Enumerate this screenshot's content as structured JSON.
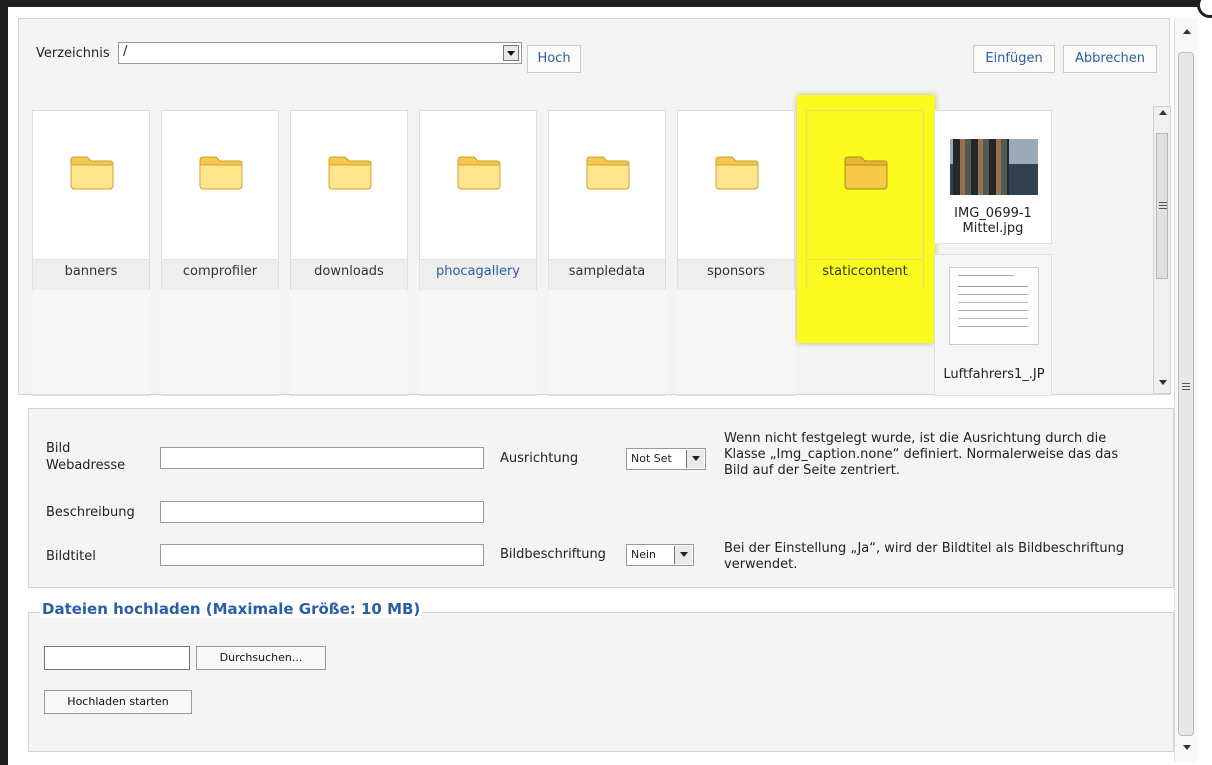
{
  "toolbar": {
    "directory_label": "Verzeichnis",
    "directory_value": "/",
    "up_button": "Hoch",
    "insert_button": "Einfügen",
    "cancel_button": "Abbrechen"
  },
  "items": [
    {
      "label": "banners",
      "type": "folder"
    },
    {
      "label": "comprofiler",
      "type": "folder"
    },
    {
      "label": "downloads",
      "type": "folder"
    },
    {
      "label": "phocagallery",
      "type": "folder"
    },
    {
      "label": "sampledata",
      "type": "folder"
    },
    {
      "label": "sponsors",
      "type": "folder"
    },
    {
      "label": "staticcontent",
      "type": "folder",
      "selected": true
    },
    {
      "label": "IMG_0699-1 Mittel.jpg",
      "type": "image"
    },
    {
      "label": "Luftfahrers1_.JP",
      "type": "image"
    }
  ],
  "form": {
    "image_url_label": "Bild Webadresse",
    "description_label": "Beschreibung",
    "title_label": "Bildtitel",
    "align_label": "Ausrichtung",
    "align_value": "Not Set",
    "align_help": "Wenn nicht festgelegt wurde, ist die Ausrichtung durch die Klasse „Img_caption.none“ definiert. Normalerweise das das Bild auf der Seite zentriert.",
    "caption_label": "Bildbeschriftung",
    "caption_value": "Nein",
    "caption_help": "Bei der Einstellung „Ja“, wird der Bildtitel als Bildbeschriftung verwendet."
  },
  "upload": {
    "legend": "Dateien hochladen (Maximale Größe: 10 MB)",
    "browse_button": "Durchsuchen...",
    "start_button": "Hochladen starten"
  },
  "icons": {
    "folder": "folder-icon",
    "dropdown": "chevron-down-icon",
    "scroll_up": "chevron-up-icon",
    "scroll_down": "chevron-down-icon"
  },
  "colors": {
    "selection": "#fbfb20",
    "link": "#2a5ea8",
    "folder": "#f1c84b"
  }
}
